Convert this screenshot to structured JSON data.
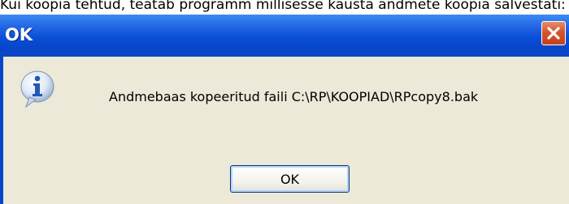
{
  "background": {
    "caption": "Kui koopia tehtud, teatab programm millisesse kausta andmete koopia salvestati:"
  },
  "dialog": {
    "title": "OK",
    "message": "Andmebaas kopeeritud faili C:\\RP\\KOOPIAD\\RPcopy8.bak",
    "ok_label": "OK",
    "icon": "information-icon",
    "colors": {
      "titlebar": "#0a4fd8",
      "body": "#ece9d8",
      "close": "#d8542c"
    }
  }
}
